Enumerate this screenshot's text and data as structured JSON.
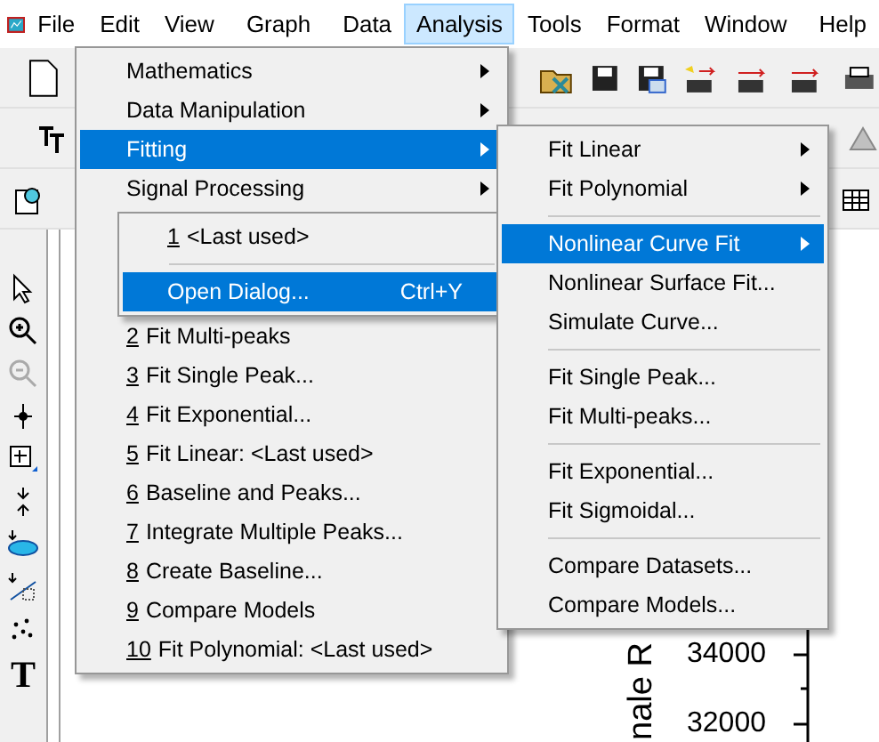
{
  "menu_bar": [
    {
      "label": "File",
      "selected": false
    },
    {
      "label": "Edit",
      "selected": false
    },
    {
      "label": "View",
      "selected": false
    },
    {
      "label": "Graph",
      "selected": false
    },
    {
      "label": "Data",
      "selected": false
    },
    {
      "label": "Analysis",
      "selected": true
    },
    {
      "label": "Tools",
      "selected": false
    },
    {
      "label": "Format",
      "selected": false
    },
    {
      "label": "Window",
      "selected": false
    },
    {
      "label": "Help",
      "selected": false
    }
  ],
  "analysis_menu": {
    "items": [
      {
        "label": "Mathematics",
        "submenu": true,
        "selected": false
      },
      {
        "label": "Data Manipulation",
        "submenu": true,
        "selected": false
      },
      {
        "label": "Fitting",
        "submenu": true,
        "selected": true
      },
      {
        "label": "Signal Processing",
        "submenu": true,
        "selected": false
      }
    ],
    "recent": [
      {
        "number": "2",
        "label": "Fit Multi-peaks"
      },
      {
        "number": "3",
        "label": "Fit Single Peak..."
      },
      {
        "number": "4",
        "label": "Fit Exponential..."
      },
      {
        "number": "5",
        "label": "Fit Linear: <Last used>"
      },
      {
        "number": "6",
        "label": "Baseline and Peaks..."
      },
      {
        "number": "7",
        "label": "Integrate Multiple Peaks..."
      },
      {
        "number": "8",
        "label": "Create Baseline..."
      },
      {
        "number": "9",
        "label": "Compare Models"
      },
      {
        "number": "10",
        "label": "Fit Polynomial: <Last used>"
      }
    ]
  },
  "fit_popup": {
    "items": [
      {
        "number": "1",
        "label": "<Last used>",
        "selected": false
      },
      {
        "label": "Open Dialog...",
        "shortcut": "Ctrl+Y",
        "selected": true
      }
    ]
  },
  "fitting_menu": {
    "groups": [
      [
        {
          "label": "Fit Linear",
          "submenu": true,
          "selected": false
        },
        {
          "label": "Fit Polynomial",
          "submenu": true,
          "selected": false
        }
      ],
      [
        {
          "label": "Nonlinear Curve Fit",
          "submenu": true,
          "selected": true
        },
        {
          "label": "Nonlinear Surface Fit...",
          "submenu": false,
          "selected": false
        },
        {
          "label": "Simulate Curve...",
          "submenu": false,
          "selected": false
        }
      ],
      [
        {
          "label": "Fit Single Peak...",
          "submenu": false,
          "selected": false
        },
        {
          "label": "Fit Multi-peaks...",
          "submenu": false,
          "selected": false
        }
      ],
      [
        {
          "label": "Fit Exponential...",
          "submenu": false,
          "selected": false
        },
        {
          "label": "Fit Sigmoidal...",
          "submenu": false,
          "selected": false
        }
      ],
      [
        {
          "label": "Compare Datasets...",
          "submenu": false,
          "selected": false
        },
        {
          "label": "Compare Models...",
          "submenu": false,
          "selected": false
        }
      ]
    ]
  },
  "left_tools": [
    {
      "kind": "pointer"
    },
    {
      "kind": "zoom-in"
    },
    {
      "kind": "zoom-out"
    },
    {
      "kind": "crosshair"
    },
    {
      "kind": "box"
    },
    {
      "kind": "arrows"
    },
    {
      "kind": "ellipse"
    },
    {
      "kind": "mask"
    },
    {
      "kind": "dots"
    },
    {
      "kind": "text",
      "glyph": "T"
    }
  ],
  "graph": {
    "axis_title": "nale R",
    "tick_labels": [
      "34000",
      "32000"
    ]
  }
}
